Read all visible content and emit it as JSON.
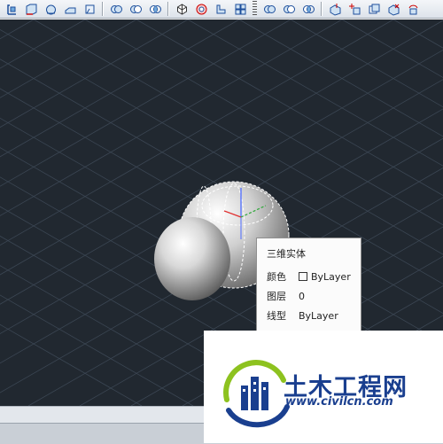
{
  "toolbar": {
    "groups": [
      [
        "ucs-icon",
        "ucs-face-icon",
        "ucs-object-icon",
        "ucs-view-icon",
        "ucs-origin-icon"
      ],
      [
        "union-icon",
        "subtract-icon",
        "intersect-icon"
      ],
      [
        "orbit-icon",
        "view-cube-icon",
        "wedge-icon",
        "cylinder-icon"
      ],
      [
        "union-icon",
        "subtract-icon",
        "intersect-icon"
      ],
      [
        "extrude-face-icon",
        "move-face-icon",
        "offset-face-icon",
        "delete-face-icon",
        "rotate-face-icon"
      ]
    ]
  },
  "tooltip": {
    "title": "三维实体",
    "rows": [
      {
        "key": "颜色",
        "value": "ByLayer",
        "swatch": true
      },
      {
        "key": "图层",
        "value": "0"
      },
      {
        "key": "线型",
        "value": "ByLayer"
      }
    ]
  },
  "watermark": {
    "name": "土木工程网",
    "url": "www.civilcn.com"
  },
  "colors": {
    "viewport_bg": "#212830",
    "grid": "#3b4653",
    "brand_blue": "#1a3f8f",
    "brand_green": "#8dc21f"
  }
}
